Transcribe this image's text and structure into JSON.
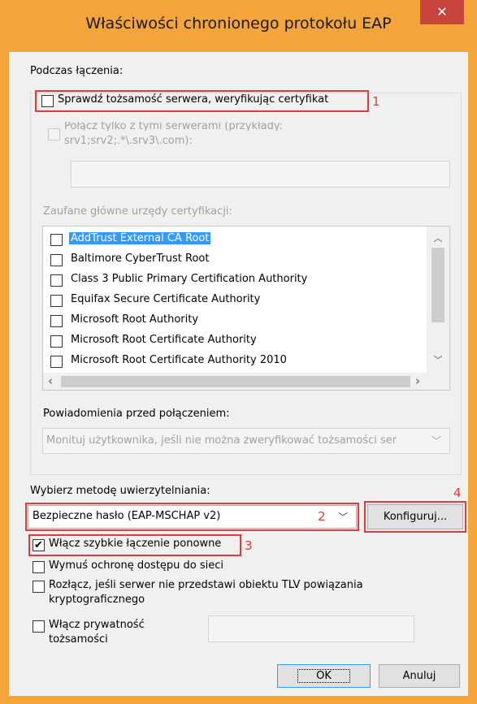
{
  "window": {
    "title": "Właściwości chronionego protokołu EAP",
    "close": "✕"
  },
  "section_connecting": "Podczas łączenia:",
  "verify_server": {
    "label": "Sprawdź tożsamość serwera, weryfikując certyfikat",
    "checked": false,
    "marker": "1"
  },
  "connect_servers": {
    "label_line1": "Połącz tylko z tymi serwerami (przykłady:",
    "label_line2": "srv1;srv2;.*\\.srv3\\.com):",
    "value": ""
  },
  "trusted_ca": {
    "label": "Zaufane główne urzędy certyfikacji:",
    "items": [
      "AddTrust External CA Root",
      "Baltimore CyberTrust Root",
      "Class 3 Public Primary Certification Authority",
      "Equifax Secure Certificate Authority",
      "Microsoft Root Authority",
      "Microsoft Root Certificate Authority",
      "Microsoft Root Certificate Authority 2010"
    ],
    "selected_index": 0
  },
  "notifications": {
    "label": "Powiadomienia przed połączeniem:",
    "value": "Monituj użytkownika, jeśli nie można zweryfikować tożsamości ser"
  },
  "auth_method": {
    "label": "Wybierz metodę uwierzytelniania:",
    "value": "Bezpieczne hasło (EAP-MSCHAP v2)",
    "marker": "2"
  },
  "configure": {
    "label": "Konfiguruj...",
    "marker": "4"
  },
  "options": [
    {
      "label": "Włącz szybkie łączenie ponowne",
      "checked": true,
      "marker": "3"
    },
    {
      "label": "Wymuś ochronę dostępu do sieci",
      "checked": false
    },
    {
      "label_line1": "Rozłącz, jeśli serwer nie przedstawi obiektu TLV powiązania",
      "label_line2": "kryptograficznego",
      "checked": false
    },
    {
      "label_line1": "Włącz prywatność",
      "label_line2": "tożsamości",
      "checked": false
    }
  ],
  "buttons": {
    "ok": "OK",
    "cancel": "Anuluj"
  },
  "colors": {
    "accent": "#f3a43a",
    "close": "#c7453c",
    "marker": "#e03a3a",
    "selection": "#3399ff"
  }
}
